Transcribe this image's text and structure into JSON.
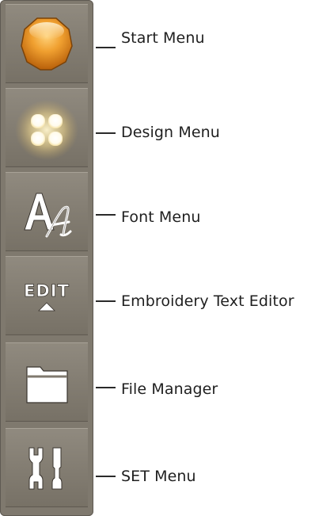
{
  "toolbar": {
    "items": [
      {
        "label": "Start Menu",
        "icon": "start-orb-icon"
      },
      {
        "label": "Design Menu",
        "icon": "design-grid-icon"
      },
      {
        "label": "Font Menu",
        "icon": "font-icon"
      },
      {
        "label": "Embroidery Text Editor",
        "icon": "edit-icon",
        "icon_text": "EDIT"
      },
      {
        "label": "File Manager",
        "icon": "folder-icon"
      },
      {
        "label": "SET Menu",
        "icon": "settings-tools-icon"
      }
    ]
  },
  "colors": {
    "toolbar_bg": "#7f796e",
    "orb_orange": "#e38a16",
    "glow": "#fff7d8",
    "icon_white": "#ffffff",
    "label_text": "#1f1f1f"
  }
}
